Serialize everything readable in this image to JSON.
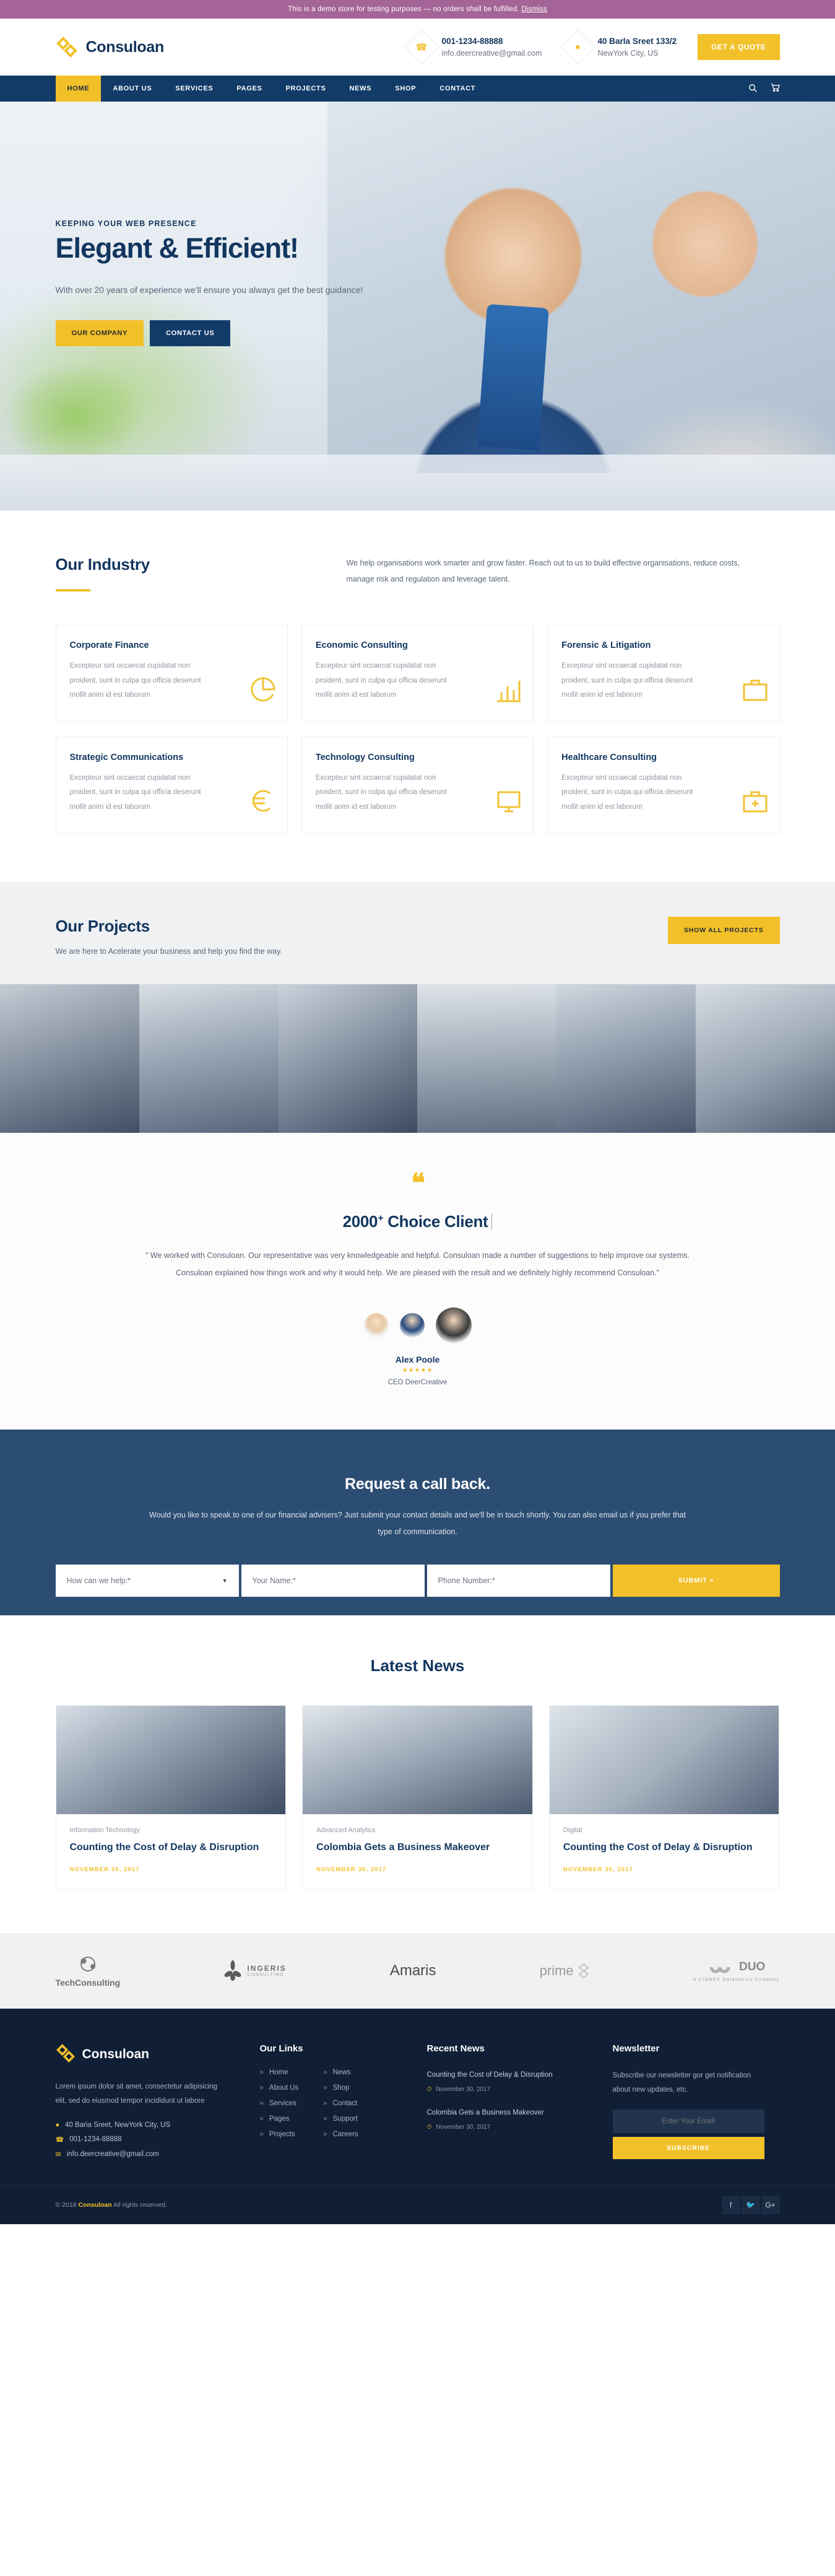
{
  "demo_bar": {
    "text": "This is a demo store for testing purposes — no orders shall be fulfilled.",
    "dismiss": "Dismiss"
  },
  "header": {
    "brand": "Consuloan",
    "phone": "001-1234-88888",
    "email": "info.deercreative@gmail.com",
    "address_line1": "40 Barla Sreet 133/2",
    "address_line2": "NewYork City, US",
    "quote_button": "GET A QUOTE"
  },
  "nav": {
    "items": [
      "HOME",
      "ABOUT US",
      "SERVICES",
      "PAGES",
      "PROJECTS",
      "NEWS",
      "SHOP",
      "CONTACT"
    ],
    "active": "HOME"
  },
  "hero": {
    "kicker": "KEEPING YOUR WEB PRESENCE",
    "title": "Elegant & Efficient!",
    "text": "With over 20 years of experience we'll ensure you always get the best guidance!",
    "btn_primary": "OUR COMPANY",
    "btn_secondary": "CONTACT US"
  },
  "industry": {
    "title": "Our Industry",
    "intro": "We help organisations work smarter and grow faster. Reach out to us to build effective organisations, reduce costs, manage risk and regulation and leverage talent.",
    "card_text": "Excepteur sint occaecat cupidatat non proident, sunt in culpa qui officia deserunt mollit anim id est laborum",
    "cards": [
      {
        "title": "Corporate Finance",
        "icon": "pie-chart-icon"
      },
      {
        "title": "Economic Consulting",
        "icon": "bar-chart-icon"
      },
      {
        "title": "Forensic & Litigation",
        "icon": "briefcase-icon"
      },
      {
        "title": "Strategic Communications",
        "icon": "euro-icon"
      },
      {
        "title": "Technology Consulting",
        "icon": "monitor-icon"
      },
      {
        "title": "Healthcare Consulting",
        "icon": "medical-case-icon"
      }
    ]
  },
  "projects": {
    "title": "Our Projects",
    "subtitle": "We are here to Acelerate your business and help you find the way.",
    "button": "SHOW ALL PROJECTS",
    "tiles": [
      "project-1",
      "project-2",
      "project-3",
      "project-4",
      "project-5",
      "project-6"
    ]
  },
  "testimonial": {
    "heading": "2000",
    "heading_plus": "+",
    "heading_rest": " Choice Client",
    "body": "\" We worked with Consuloan. Our representative was very knowledgeable and helpful. Consuloan made a number of suggestions to help improve our systems. Consuloan explained how things work and why it would help. We are pleased with the result and we definitely highly recommend Consuloan.\"",
    "name": "Alex Poole",
    "stars": "★★★★★",
    "role": "CEO DeerCreative"
  },
  "callback": {
    "title": "Request a call back.",
    "text": "Would you like to speak to one of our financial advisers? Just submit your contact details and we'll be in touch shortly. You can also email us if you prefer that type of communication.",
    "select_value": "How can we help:*",
    "name_placeholder": "Your Name:*",
    "phone_placeholder": "Phone Number:*",
    "submit": "SUBMIT »"
  },
  "news": {
    "title": "Latest News",
    "items": [
      {
        "category": "Information Technology",
        "title": "Counting the Cost of Delay & Disruption",
        "date": "NOVEMBER 30, 2017"
      },
      {
        "category": "Advanced Analytics",
        "title": "Colombia Gets a Business Makeover",
        "date": "NOVEMBER 30, 2017"
      },
      {
        "category": "Digital",
        "title": "Counting the Cost of Delay & Disruption",
        "date": "NOVEMBER 30, 2017"
      }
    ]
  },
  "clients": [
    {
      "name": "TechConsulting",
      "sub": ""
    },
    {
      "name": "INGERIS",
      "sub": "CONSULTING"
    },
    {
      "name": "Amaris",
      "sub": ""
    },
    {
      "name": "prime",
      "sub": ""
    },
    {
      "name": "DUO",
      "sub": "A CIGNEX Datamatics Company"
    }
  ],
  "footer": {
    "brand": "Consuloan",
    "about": "Lorem ipsum dolor sit amet, consectetur adipisicing elit, sed do eiusmod tempor incididunt ut labore",
    "address": "40 Baria Sreet, NewYork City, US",
    "phone": "001-1234-88888",
    "email": "info.deercreative@gmail.com",
    "links_heading": "Our Links",
    "links_col1": [
      "Home",
      "About Us",
      "Services",
      "Pages",
      "Projects"
    ],
    "links_col2": [
      "News",
      "Shop",
      "Contact",
      "Support",
      "Careers"
    ],
    "news_heading": "Recent News",
    "recent_news": [
      {
        "title": "Counting the Cost of Delay & Disruption",
        "date": "November 30, 2017"
      },
      {
        "title": "Colombia Gets a Business Makeover",
        "date": "November 30, 2017"
      }
    ],
    "newsletter_heading": "Newsletter",
    "newsletter_text": "Subscribe our newsletter gor get notification about new updates, etc.",
    "email_placeholder": "Enter Your Email",
    "subscribe": "SUBSCRIBE",
    "copyright_pre": "© 2018 ",
    "copyright_brand": "Consuloan",
    "copyright_post": " All rights reserved.",
    "socials": [
      "facebook-icon",
      "twitter-icon",
      "google-plus-icon"
    ]
  },
  "colors": {
    "accent": "#f2c029",
    "navy": "#123b68",
    "dark": "#101f35",
    "demo": "#a46497"
  }
}
